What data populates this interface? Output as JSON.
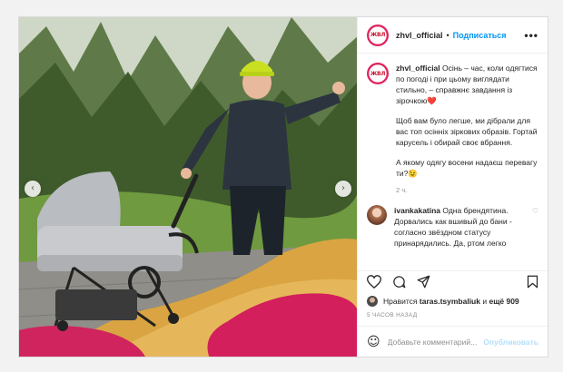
{
  "post": {
    "username": "zhvl_official",
    "avatar_text": "ЖВЛ",
    "separator": "•",
    "follow_label": "Подписаться",
    "more_label": "•••",
    "caption": {
      "username": "zhvl_official",
      "line1": "Осінь – час, коли одягтися по погоді і при цьому виглядати стильно, – справжнє завдання із зірочкою❤️",
      "line2": "Щоб вам було легше, ми дібрали для вас топ осінніх зіркових образів. Гортай карусель і обирай своє вбрання.",
      "line3": "А якому одягу восени надаєш перевагу ти?😉"
    },
    "caption_time": "2 ч.",
    "comment": {
      "username": "ivankakatina",
      "text": "Одна брендятина. Дорвались как вшивый до бани - согласно звёздном статусу принарядились. Да, ртом легко"
    },
    "likes": {
      "prefix": "Нравится",
      "user": "taras.tsymbaliuk",
      "mid": "и",
      "count": "ещё 909"
    },
    "date": "5 ЧАСОВ НАЗАД",
    "input_placeholder": "Добавьте комментарий...",
    "publish_label": "Опубликовать"
  },
  "icons": {
    "prev": "chevron-left-icon",
    "next": "chevron-right-icon",
    "like": "heart-icon",
    "comment": "comment-icon",
    "share": "share-icon",
    "save": "bookmark-icon",
    "emoji": "emoji-icon"
  },
  "colors": {
    "link_blue": "#0095f6",
    "publish_disabled": "#b2dffc",
    "brand_red": "#c8102e"
  }
}
